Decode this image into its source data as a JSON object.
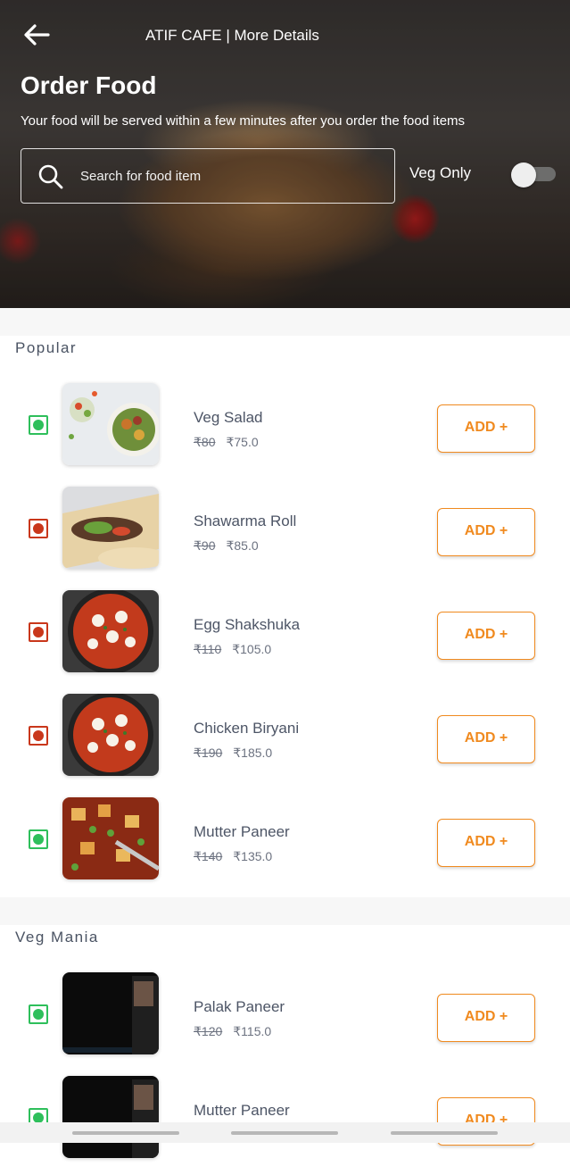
{
  "header": {
    "back_icon": "arrow-left-icon",
    "title": "ATIF CAFE | More Details",
    "heading": "Order Food",
    "subtitle": "Your food will be served within a few minutes after you order the food items"
  },
  "search": {
    "icon": "search-icon",
    "placeholder": "Search for food item"
  },
  "filter": {
    "veg_only_label": "Veg Only",
    "veg_only_on": false
  },
  "colors": {
    "accent": "#f08a1f",
    "veg": "#2ebf5b",
    "nonveg": "#c9371b",
    "text": "#4d5566"
  },
  "sections": [
    {
      "title": "Popular",
      "items": [
        {
          "name": "Veg Salad",
          "old_price": "₹80",
          "price": "₹75.0",
          "type": "veg",
          "add_label": "ADD +"
        },
        {
          "name": "Shawarma Roll",
          "old_price": "₹90",
          "price": "₹85.0",
          "type": "nonveg",
          "add_label": "ADD +"
        },
        {
          "name": "Egg Shakshuka",
          "old_price": "₹110",
          "price": "₹105.0",
          "type": "nonveg",
          "add_label": "ADD +"
        },
        {
          "name": "Chicken Biryani",
          "old_price": "₹190",
          "price": "₹185.0",
          "type": "nonveg",
          "add_label": "ADD +"
        },
        {
          "name": "Mutter Paneer",
          "old_price": "₹140",
          "price": "₹135.0",
          "type": "veg",
          "add_label": "ADD +"
        }
      ]
    },
    {
      "title": "Veg Mania",
      "items": [
        {
          "name": "Palak Paneer",
          "old_price": "₹120",
          "price": "₹115.0",
          "type": "veg",
          "add_label": "ADD +"
        },
        {
          "name": "Mutter Paneer",
          "old_price": "",
          "price": "",
          "type": "veg",
          "add_label": "ADD +"
        }
      ]
    }
  ]
}
